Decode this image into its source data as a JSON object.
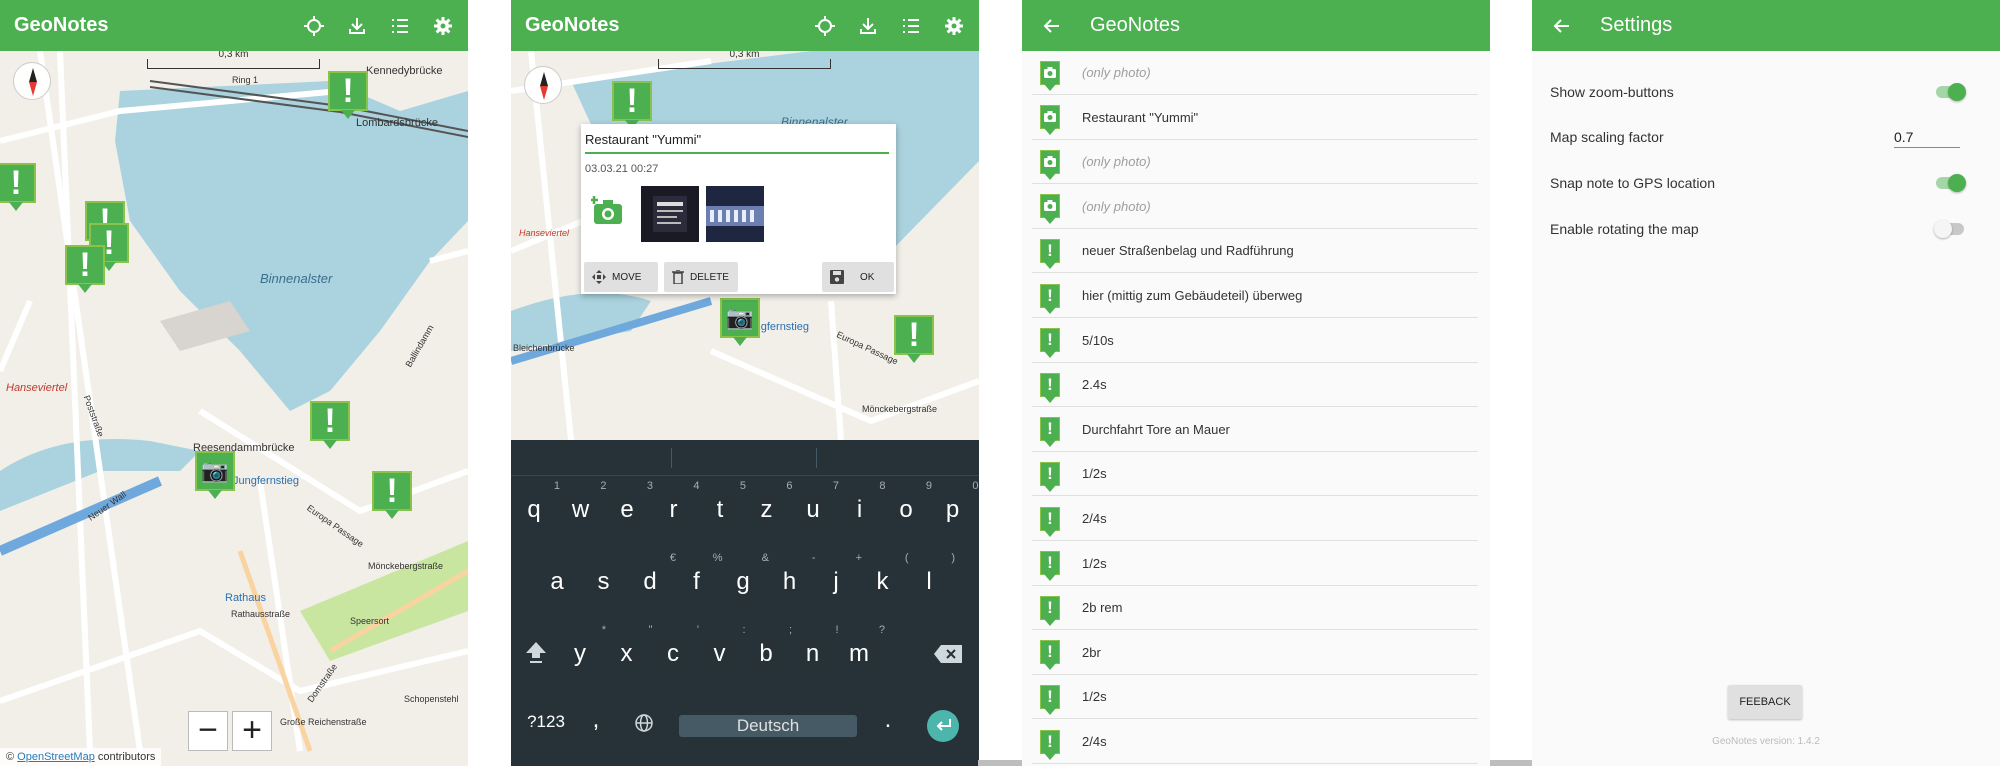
{
  "app_name": "GeoNotes",
  "colors": {
    "primary": "#4caf50",
    "accent": "#4db6ac",
    "keyboard_bg": "#263238"
  },
  "icons": {
    "locate": "crosshair-icon",
    "download": "download-icon",
    "list": "list-icon",
    "settings": "gear-icon",
    "back": "back-arrow-icon"
  },
  "map_screen": {
    "scale_label": "0,3 km",
    "street_labels": [
      "Ring 1",
      "Kennedybrücke",
      "Lombardsbrücke",
      "Binnenalster",
      "Reesendammbrücke",
      "Jungfernstieg",
      "Rathaus",
      "Mönckebergstraße",
      "Hanseviertel",
      "Große Reichenstraße",
      "Domstraße",
      "Schopenstehl",
      "Rathausstraße",
      "Neuer Wall",
      "Poststraße",
      "Europa Passage",
      "Ballindamm",
      "Speersort"
    ],
    "zoom_out": "−",
    "zoom_in": "+",
    "attribution_prefix": "© ",
    "attribution_link": "OpenStreetMap",
    "attribution_suffix": " contributors"
  },
  "edit_screen": {
    "scale_label": "0,3 km",
    "note_title": "Restaurant \"Yummi\"",
    "note_date": "03.03.21 00:27",
    "move_label": "MOVE",
    "delete_label": "DELETE",
    "ok_label": "OK",
    "street_labels": [
      "Binnenalster",
      "Bleichenbrücke",
      "Jungfernstieg",
      "Europa Passage",
      "Mönckebergstraße",
      "Hanseviertel"
    ],
    "keyboard": {
      "row1": [
        {
          "k": "q",
          "s": "1"
        },
        {
          "k": "w",
          "s": "2"
        },
        {
          "k": "e",
          "s": "3"
        },
        {
          "k": "r",
          "s": "4"
        },
        {
          "k": "t",
          "s": "5"
        },
        {
          "k": "z",
          "s": "6"
        },
        {
          "k": "u",
          "s": "7"
        },
        {
          "k": "i",
          "s": "8"
        },
        {
          "k": "o",
          "s": "9"
        },
        {
          "k": "p",
          "s": "0"
        }
      ],
      "row2": [
        {
          "k": "a",
          "s": ""
        },
        {
          "k": "s",
          "s": ""
        },
        {
          "k": "d",
          "s": "€"
        },
        {
          "k": "f",
          "s": "%"
        },
        {
          "k": "g",
          "s": "&"
        },
        {
          "k": "h",
          "s": "-"
        },
        {
          "k": "j",
          "s": "+"
        },
        {
          "k": "k",
          "s": "("
        },
        {
          "k": "l",
          "s": ")"
        }
      ],
      "row3": [
        {
          "k": "y",
          "s": "*"
        },
        {
          "k": "x",
          "s": "\""
        },
        {
          "k": "c",
          "s": "'"
        },
        {
          "k": "v",
          "s": ":"
        },
        {
          "k": "b",
          "s": ";"
        },
        {
          "k": "n",
          "s": "!"
        },
        {
          "k": "m",
          "s": "?"
        }
      ],
      "symbols_key": "?123",
      "comma": ",",
      "space_label": "Deutsch",
      "period": "."
    }
  },
  "list_screen": {
    "notes": [
      {
        "label": "(only photo)",
        "type": "photo",
        "muted": true
      },
      {
        "label": "Restaurant \"Yummi\"",
        "type": "photo",
        "muted": false
      },
      {
        "label": "(only photo)",
        "type": "photo",
        "muted": true
      },
      {
        "label": "(only photo)",
        "type": "photo",
        "muted": true
      },
      {
        "label": "neuer Straßenbelag und Radführung",
        "type": "note",
        "muted": false
      },
      {
        "label": "hier (mittig zum Gebäudeteil) überweg",
        "type": "note",
        "muted": false
      },
      {
        "label": "5/10s",
        "type": "note",
        "muted": false
      },
      {
        "label": "2.4s",
        "type": "note",
        "muted": false
      },
      {
        "label": "Durchfahrt Tore an Mauer",
        "type": "note",
        "muted": false
      },
      {
        "label": "1/2s",
        "type": "note",
        "muted": false
      },
      {
        "label": "2/4s",
        "type": "note",
        "muted": false
      },
      {
        "label": "1/2s",
        "type": "note",
        "muted": false
      },
      {
        "label": "2b rem",
        "type": "note",
        "muted": false
      },
      {
        "label": "2br",
        "type": "note",
        "muted": false
      },
      {
        "label": "1/2s",
        "type": "note",
        "muted": false
      },
      {
        "label": "2/4s",
        "type": "note",
        "muted": false
      }
    ]
  },
  "settings_screen": {
    "title": "Settings",
    "show_zoom_label": "Show zoom-buttons",
    "show_zoom_on": true,
    "scaling_label": "Map scaling factor",
    "scaling_value": "0.7",
    "snap_label": "Snap note to GPS location",
    "snap_on": true,
    "rotate_label": "Enable rotating the map",
    "rotate_on": false,
    "feedback_label": "FEEBACK",
    "version_text": "GeoNotes version: 1.4.2"
  }
}
